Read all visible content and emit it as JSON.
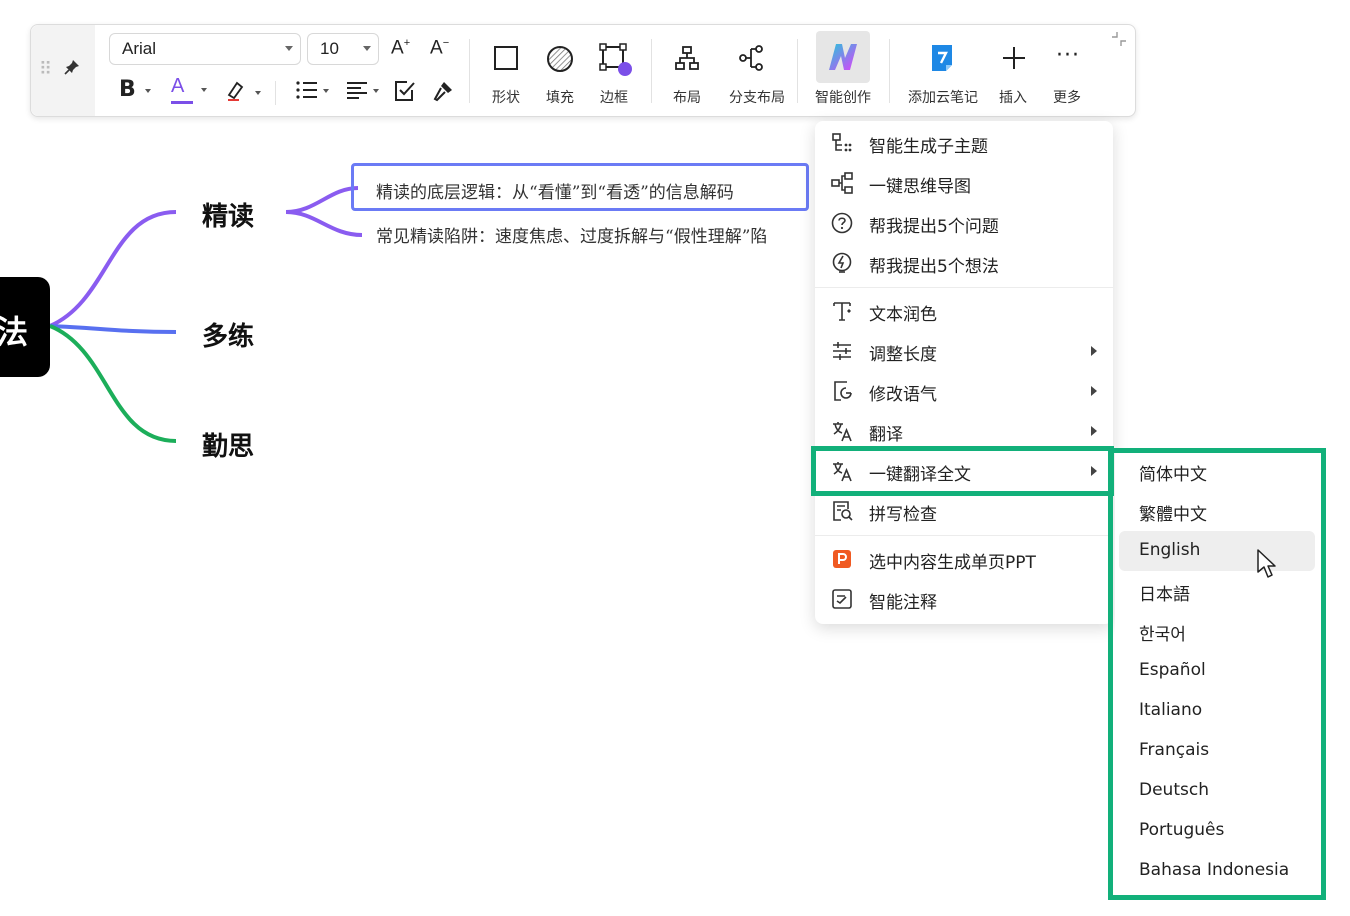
{
  "toolbar": {
    "font_family": "Arial",
    "font_size": "10",
    "increase_font": "A+",
    "decrease_font": "A−",
    "bold": "B",
    "text_color_glyph": "A",
    "buttons": [
      {
        "label": "形状",
        "icon": "square-icon"
      },
      {
        "label": "填充",
        "icon": "fill-icon"
      },
      {
        "label": "边框",
        "icon": "border-icon"
      },
      {
        "label": "布局",
        "icon": "layout-icon"
      },
      {
        "label": "分支布局",
        "icon": "branch-layout-icon"
      },
      {
        "label": "智能创作",
        "icon": "ai-create-icon"
      },
      {
        "label": "添加云笔记",
        "icon": "cloud-note-icon"
      },
      {
        "label": "插入",
        "icon": "plus-icon"
      },
      {
        "label": "更多",
        "icon": "more-icon"
      }
    ],
    "colors": {
      "text_color_underline": "#7b4fe8",
      "border_dot": "#7b4fe8",
      "ai_gradient_start": "#26c6da",
      "ai_gradient_end": "#e040fb",
      "cloud_note": "#1e88e5"
    }
  },
  "mindmap": {
    "root_label": "法",
    "topics": [
      {
        "label": "精读",
        "branch_color": "#8a5cf0"
      },
      {
        "label": "多练",
        "branch_color": "#5870f0"
      },
      {
        "label": "勤思",
        "branch_color": "#1cae5a"
      }
    ],
    "subtopics": [
      "精读的底层逻辑：从“看懂”到“看透”的信息解码",
      "常见精读陷阱：速度焦虑、过度拆解与“假性理解”陷"
    ]
  },
  "ai_menu": {
    "items": [
      {
        "label": "智能生成子主题",
        "icon": "sub-topic-icon",
        "submenu": false
      },
      {
        "label": "一键思维导图",
        "icon": "mindmap-icon",
        "submenu": false
      },
      {
        "label": "帮我提出5个问题",
        "icon": "question-icon",
        "submenu": false
      },
      {
        "label": "帮我提出5个想法",
        "icon": "bulb-icon",
        "submenu": false
      },
      {
        "label": "文本润色",
        "icon": "polish-icon",
        "submenu": false
      },
      {
        "label": "调整长度",
        "icon": "adjust-length-icon",
        "submenu": true
      },
      {
        "label": "修改语气",
        "icon": "tone-icon",
        "submenu": true
      },
      {
        "label": "翻译",
        "icon": "translate-icon",
        "submenu": true
      },
      {
        "label": "一键翻译全文",
        "icon": "translate-all-icon",
        "submenu": true
      },
      {
        "label": "拼写检查",
        "icon": "spell-check-icon",
        "submenu": false
      },
      {
        "label": "选中内容生成单页PPT",
        "icon": "ppt-icon",
        "submenu": false
      },
      {
        "label": "智能注释",
        "icon": "annotation-icon",
        "submenu": false
      }
    ],
    "highlight_color": "#12b07a"
  },
  "language_menu": {
    "items": [
      "简体中文",
      "繁體中文",
      "English",
      "日本語",
      "한국어",
      "Español",
      "Italiano",
      "Français",
      "Deutsch",
      "Português",
      "Bahasa Indonesia"
    ],
    "hovered": "English"
  }
}
